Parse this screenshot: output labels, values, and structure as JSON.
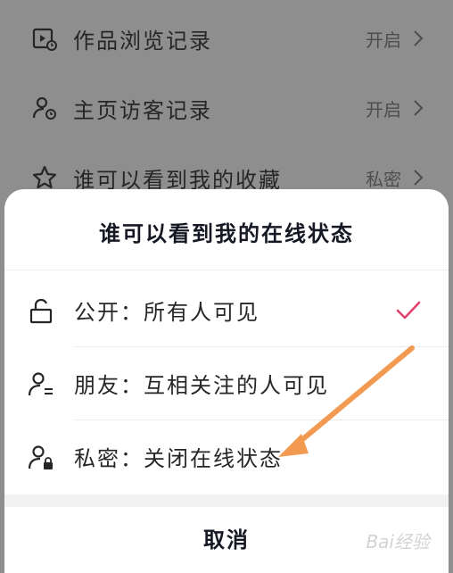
{
  "background_list": {
    "items": [
      {
        "label": "作品浏览记录",
        "value": "开启"
      },
      {
        "label": "主页访客记录",
        "value": "开启"
      },
      {
        "label": "谁可以看到我的收藏",
        "value": "私密"
      }
    ]
  },
  "sheet": {
    "title": "谁可以看到我的在线状态",
    "options": [
      {
        "label": "公开：所有人可见",
        "selected": true
      },
      {
        "label": "朋友：互相关注的人可见",
        "selected": false
      },
      {
        "label": "私密：关闭在线状态",
        "selected": false
      }
    ],
    "cancel_label": "取消"
  },
  "colors": {
    "check": "#e0446a",
    "arrow": "#f29a52"
  },
  "watermark": {
    "text": "Bai经验"
  }
}
